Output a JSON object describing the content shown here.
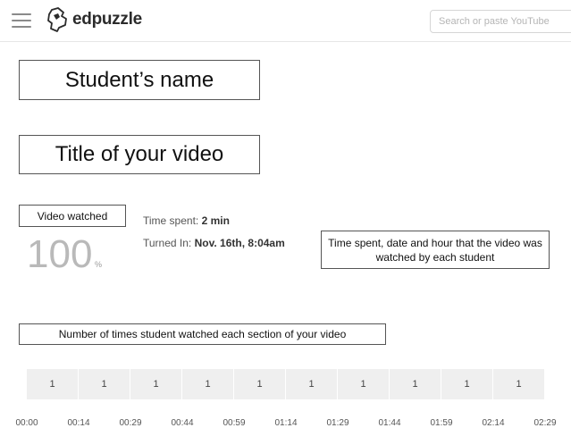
{
  "header": {
    "logo_text": "edpuzzle",
    "search_placeholder": "Search or paste YouTube"
  },
  "labels": {
    "student_name": "Student’s name",
    "video_title": "Title of your video",
    "video_watched": "Video watched",
    "annotation_time": "Time spent, date and hour that the video was watched by each student",
    "annotation_sections": "Number of times student watched each section of your video"
  },
  "progress": {
    "value": "100",
    "unit": "%"
  },
  "stats": {
    "time_spent_label": "Time spent:",
    "time_spent_value": "2 min",
    "turned_in_label": "Turned In:",
    "turned_in_value": "Nov. 16th, 8:04am"
  },
  "sections": {
    "counts": [
      "1",
      "1",
      "1",
      "1",
      "1",
      "1",
      "1",
      "1",
      "1",
      "1"
    ],
    "ticks": [
      "00:00",
      "00:14",
      "00:29",
      "00:44",
      "00:59",
      "01:14",
      "01:29",
      "01:44",
      "01:59",
      "02:14",
      "02:29"
    ]
  },
  "colors": {
    "segment_bg": "#efefef",
    "percent_text": "#b9b9b9"
  }
}
